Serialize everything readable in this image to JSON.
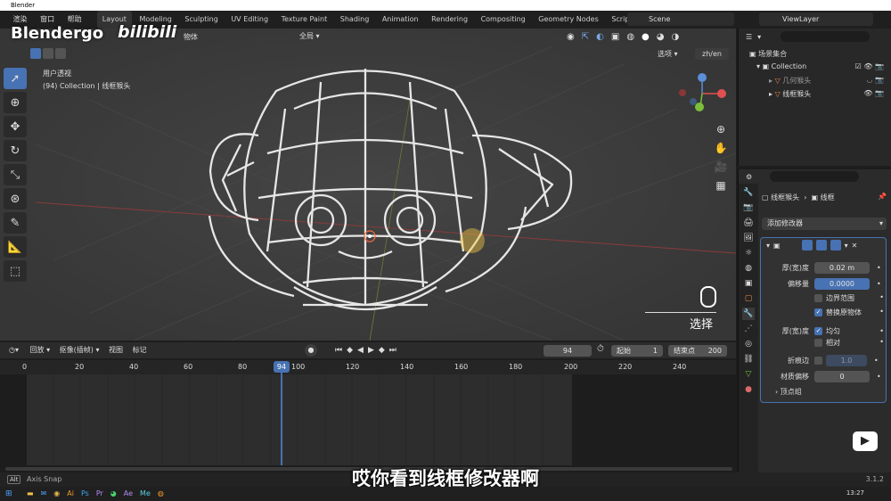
{
  "window": {
    "title": "Blender"
  },
  "watermark": {
    "brand": "Blendergo",
    "site": "bilibili"
  },
  "menu": {
    "items": [
      "渲染",
      "窗口",
      "帮助"
    ]
  },
  "workspaces": [
    "Layout",
    "Modeling",
    "Sculpting",
    "UV Editing",
    "Texture Paint",
    "Shading",
    "Animation",
    "Rendering",
    "Compositing",
    "Geometry Nodes",
    "Scripting"
  ],
  "active_workspace": "Layout",
  "scene": {
    "label": "Scene",
    "view_layer": "ViewLayer"
  },
  "viewport": {
    "header_menu_object": "物体",
    "transform_orientation": "全局",
    "options_label": "选项",
    "lang_toggle": "zh/en",
    "view_name": "用户透视",
    "collection_info": "(94) Collection | 线框猴头",
    "click_overlay_label": "选择"
  },
  "outliner": {
    "root": "场景集合",
    "collection": "Collection",
    "items": [
      {
        "name": "几何猴头"
      },
      {
        "name": "线框猴头"
      }
    ]
  },
  "properties": {
    "object_name": "线框猴头",
    "modifier_name": "线框",
    "add_modifier": "添加修改器",
    "fields": {
      "thickness_label": "厚(宽)度",
      "thickness_value": "0.02 m",
      "offset_label": "偏移量",
      "offset_value": "0.0000",
      "boundary_label": "边界范围",
      "replace_label": "替换原物体",
      "thickness_group_label": "厚(宽)度",
      "even_label": "均匀",
      "relative_label": "相对",
      "crease_label": "折痕边",
      "crease_value": "1.0",
      "material_offset_label": "材质偏移",
      "material_offset_value": "0",
      "vertex_group_label": "顶点组"
    },
    "checkboxes": {
      "boundary": false,
      "replace": true,
      "even": true,
      "relative": false,
      "crease": false
    }
  },
  "timeline": {
    "menu": [
      "回放",
      "抠像(插帧)",
      "视图",
      "标记"
    ],
    "current_frame": "94",
    "start_label": "起始",
    "start_value": "1",
    "end_label": "结束点",
    "end_value": "200",
    "ruler_ticks": [
      "0",
      "20",
      "40",
      "60",
      "80",
      "100",
      "120",
      "140",
      "160",
      "180",
      "200",
      "220",
      "240"
    ],
    "playhead_label": "94"
  },
  "status": {
    "left": "Axis Snap",
    "version": "3.1.2"
  },
  "subtitle": "哎你看到线框修改器啊",
  "taskbar": {
    "time": "13:27"
  },
  "colors": {
    "accent": "#4772b3",
    "viewport_bg": "#3b3b3b",
    "selection": "#f5c542"
  }
}
